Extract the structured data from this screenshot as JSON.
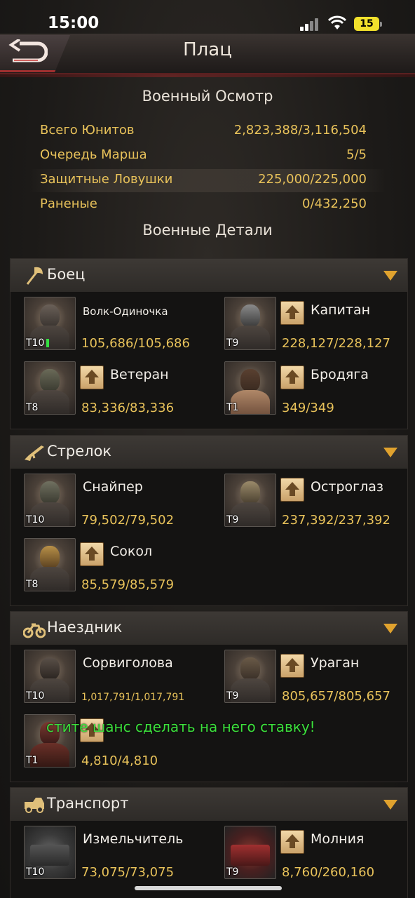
{
  "status": {
    "time": "15:00",
    "battery": "15"
  },
  "header": {
    "title": "Плац"
  },
  "overview": {
    "title": "Военный Осмотр",
    "rows": [
      {
        "label": "Всего Юнитов",
        "value": "2,823,388/3,116,504"
      },
      {
        "label": "Очередь Марша",
        "value": "5/5"
      },
      {
        "label": "Защитные Ловушки",
        "value": "225,000/225,000"
      },
      {
        "label": "Раненые",
        "value": "0/432,250"
      }
    ]
  },
  "details": {
    "title": "Военные Детали"
  },
  "categories": [
    {
      "name": "Боец",
      "units": [
        {
          "name": "Волк-Одиночка",
          "tier": "T10",
          "count": "105,686/105,686"
        },
        {
          "name": "Капитан",
          "tier": "T9",
          "count": "228,127/228,127"
        },
        {
          "name": "Ветеран",
          "tier": "T8",
          "count": "83,336/83,336"
        },
        {
          "name": "Бродяга",
          "tier": "T1",
          "count": "349/349"
        }
      ]
    },
    {
      "name": "Стрелок",
      "units": [
        {
          "name": "Снайпер",
          "tier": "T10",
          "count": "79,502/79,502"
        },
        {
          "name": "Остроглаз",
          "tier": "T9",
          "count": "237,392/237,392"
        },
        {
          "name": "Сокол",
          "tier": "T8",
          "count": "85,579/85,579"
        }
      ]
    },
    {
      "name": "Наездник",
      "units": [
        {
          "name": "Сорвиголова",
          "tier": "T10",
          "count": "1,017,791/1,017,791"
        },
        {
          "name": "Ураган",
          "tier": "T9",
          "count": "805,657/805,657"
        },
        {
          "name": "",
          "tier": "T1",
          "count": "4,810/4,810"
        }
      ]
    },
    {
      "name": "Транспорт",
      "units": [
        {
          "name": "Измельчитель",
          "tier": "T10",
          "count": "73,075/73,075"
        },
        {
          "name": "Молния",
          "tier": "T9",
          "count": "8,760/260,160"
        }
      ]
    }
  ],
  "marquee": "стите шанс сделать на него ставку!"
}
